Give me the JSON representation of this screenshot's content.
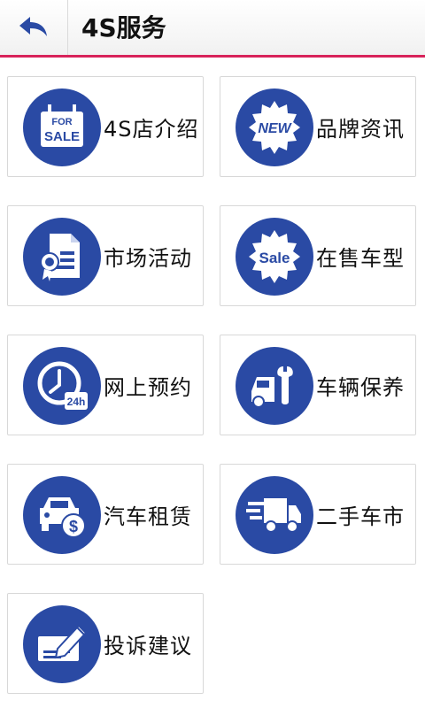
{
  "header": {
    "title": "4S服务",
    "back_icon": "back-arrow-icon"
  },
  "tiles": [
    {
      "label": "4S店介绍",
      "icon": "for-sale-sign-icon",
      "icon_text_top": "FOR",
      "icon_text_bottom": "SALE"
    },
    {
      "label": "品牌资讯",
      "icon": "new-badge-icon",
      "icon_text": "NEW"
    },
    {
      "label": "市场活动",
      "icon": "certificate-document-icon"
    },
    {
      "label": "在售车型",
      "icon": "sale-badge-icon",
      "icon_text": "Sale"
    },
    {
      "label": "网上预约",
      "icon": "clock-24h-icon",
      "icon_text": "24h"
    },
    {
      "label": "车辆保养",
      "icon": "car-wrench-icon"
    },
    {
      "label": "汽车租赁",
      "icon": "car-dollar-icon",
      "icon_text": "$"
    },
    {
      "label": "二手车市",
      "icon": "moving-truck-icon"
    },
    {
      "label": "投诉建议",
      "icon": "pen-checkbook-icon"
    }
  ],
  "colors": {
    "accent": "#2a4aa4",
    "header_line": "#d8235a",
    "back_arrow": "#2a4aa4"
  }
}
